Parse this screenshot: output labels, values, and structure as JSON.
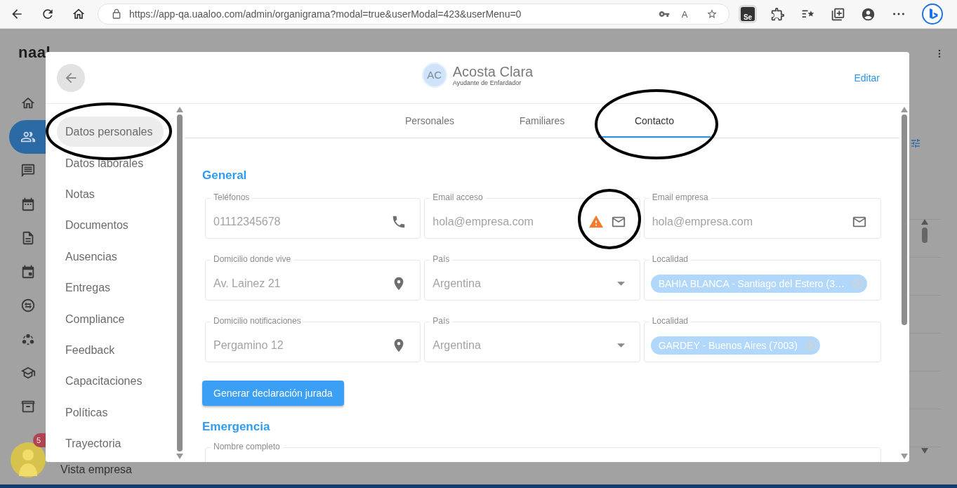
{
  "browser": {
    "url": "https://app-qa.uaaloo.com/admin/organigrama?modal=true&userModal=423&userMenu=0",
    "read_aloud": "A",
    "extension": "Se"
  },
  "app": {
    "logo": "naal",
    "rail": [
      {
        "kind": "home",
        "selected": false
      },
      {
        "kind": "people",
        "selected": true
      },
      {
        "kind": "chat",
        "selected": false
      },
      {
        "kind": "calendar",
        "selected": false
      },
      {
        "kind": "document",
        "selected": false
      },
      {
        "kind": "event",
        "selected": false
      },
      {
        "kind": "swap",
        "selected": false
      },
      {
        "kind": "bubbles",
        "selected": false
      },
      {
        "kind": "school",
        "selected": false
      },
      {
        "kind": "archive",
        "selected": false
      }
    ],
    "notification_count": "5",
    "footer_link": "Vista empresa"
  },
  "modal": {
    "initials": "AC",
    "name": "Acosta Clara",
    "role": "Ayudante de Enfardador",
    "edit": "Editar",
    "nav": [
      {
        "label": "Datos personales",
        "selected": true
      },
      {
        "label": "Datos laborales",
        "selected": false
      },
      {
        "label": "Notas",
        "selected": false
      },
      {
        "label": "Documentos",
        "selected": false
      },
      {
        "label": "Ausencias",
        "selected": false
      },
      {
        "label": "Entregas",
        "selected": false
      },
      {
        "label": "Compliance",
        "selected": false
      },
      {
        "label": "Feedback",
        "selected": false
      },
      {
        "label": "Capacitaciones",
        "selected": false
      },
      {
        "label": "Políticas",
        "selected": false
      },
      {
        "label": "Trayectoria",
        "selected": false
      }
    ],
    "tabs": [
      {
        "label": "Personales",
        "selected": false
      },
      {
        "label": "Familiares",
        "selected": false
      },
      {
        "label": "Contacto",
        "selected": true
      }
    ],
    "sections": [
      {
        "title": "General",
        "fields": [
          {
            "label": "Teléfonos",
            "value": "01112345678",
            "kind": "phone"
          },
          {
            "label": "Email acceso",
            "value": "hola@empresa.com",
            "kind": "email",
            "warning": true
          },
          {
            "label": "Email empresa",
            "value": "hola@empresa.com",
            "kind": "email",
            "warning": false
          },
          {
            "label": "Domicilio donde vive",
            "value": "Av. Lainez 21",
            "kind": "address"
          },
          {
            "label": "País",
            "value": "Argentina",
            "kind": "select"
          },
          {
            "label": "Localidad",
            "chips": [
              "BAHIA BLANCA - Santiago del Estero (3…"
            ],
            "kind": "chips"
          },
          {
            "label": "Domicilio notificaciones",
            "value": "Pergamino 12",
            "kind": "address"
          },
          {
            "label": "País",
            "value": "Argentina",
            "kind": "select"
          },
          {
            "label": "Localidad",
            "chips": [
              "GARDEY - Buenos Aires (7003)"
            ],
            "kind": "chips"
          }
        ],
        "action": "Generar declaración jurada"
      },
      {
        "title": "Emergencia",
        "fields": [
          {
            "label": "Nombre completo",
            "kind": "text",
            "wide": true
          }
        ]
      }
    ]
  }
}
